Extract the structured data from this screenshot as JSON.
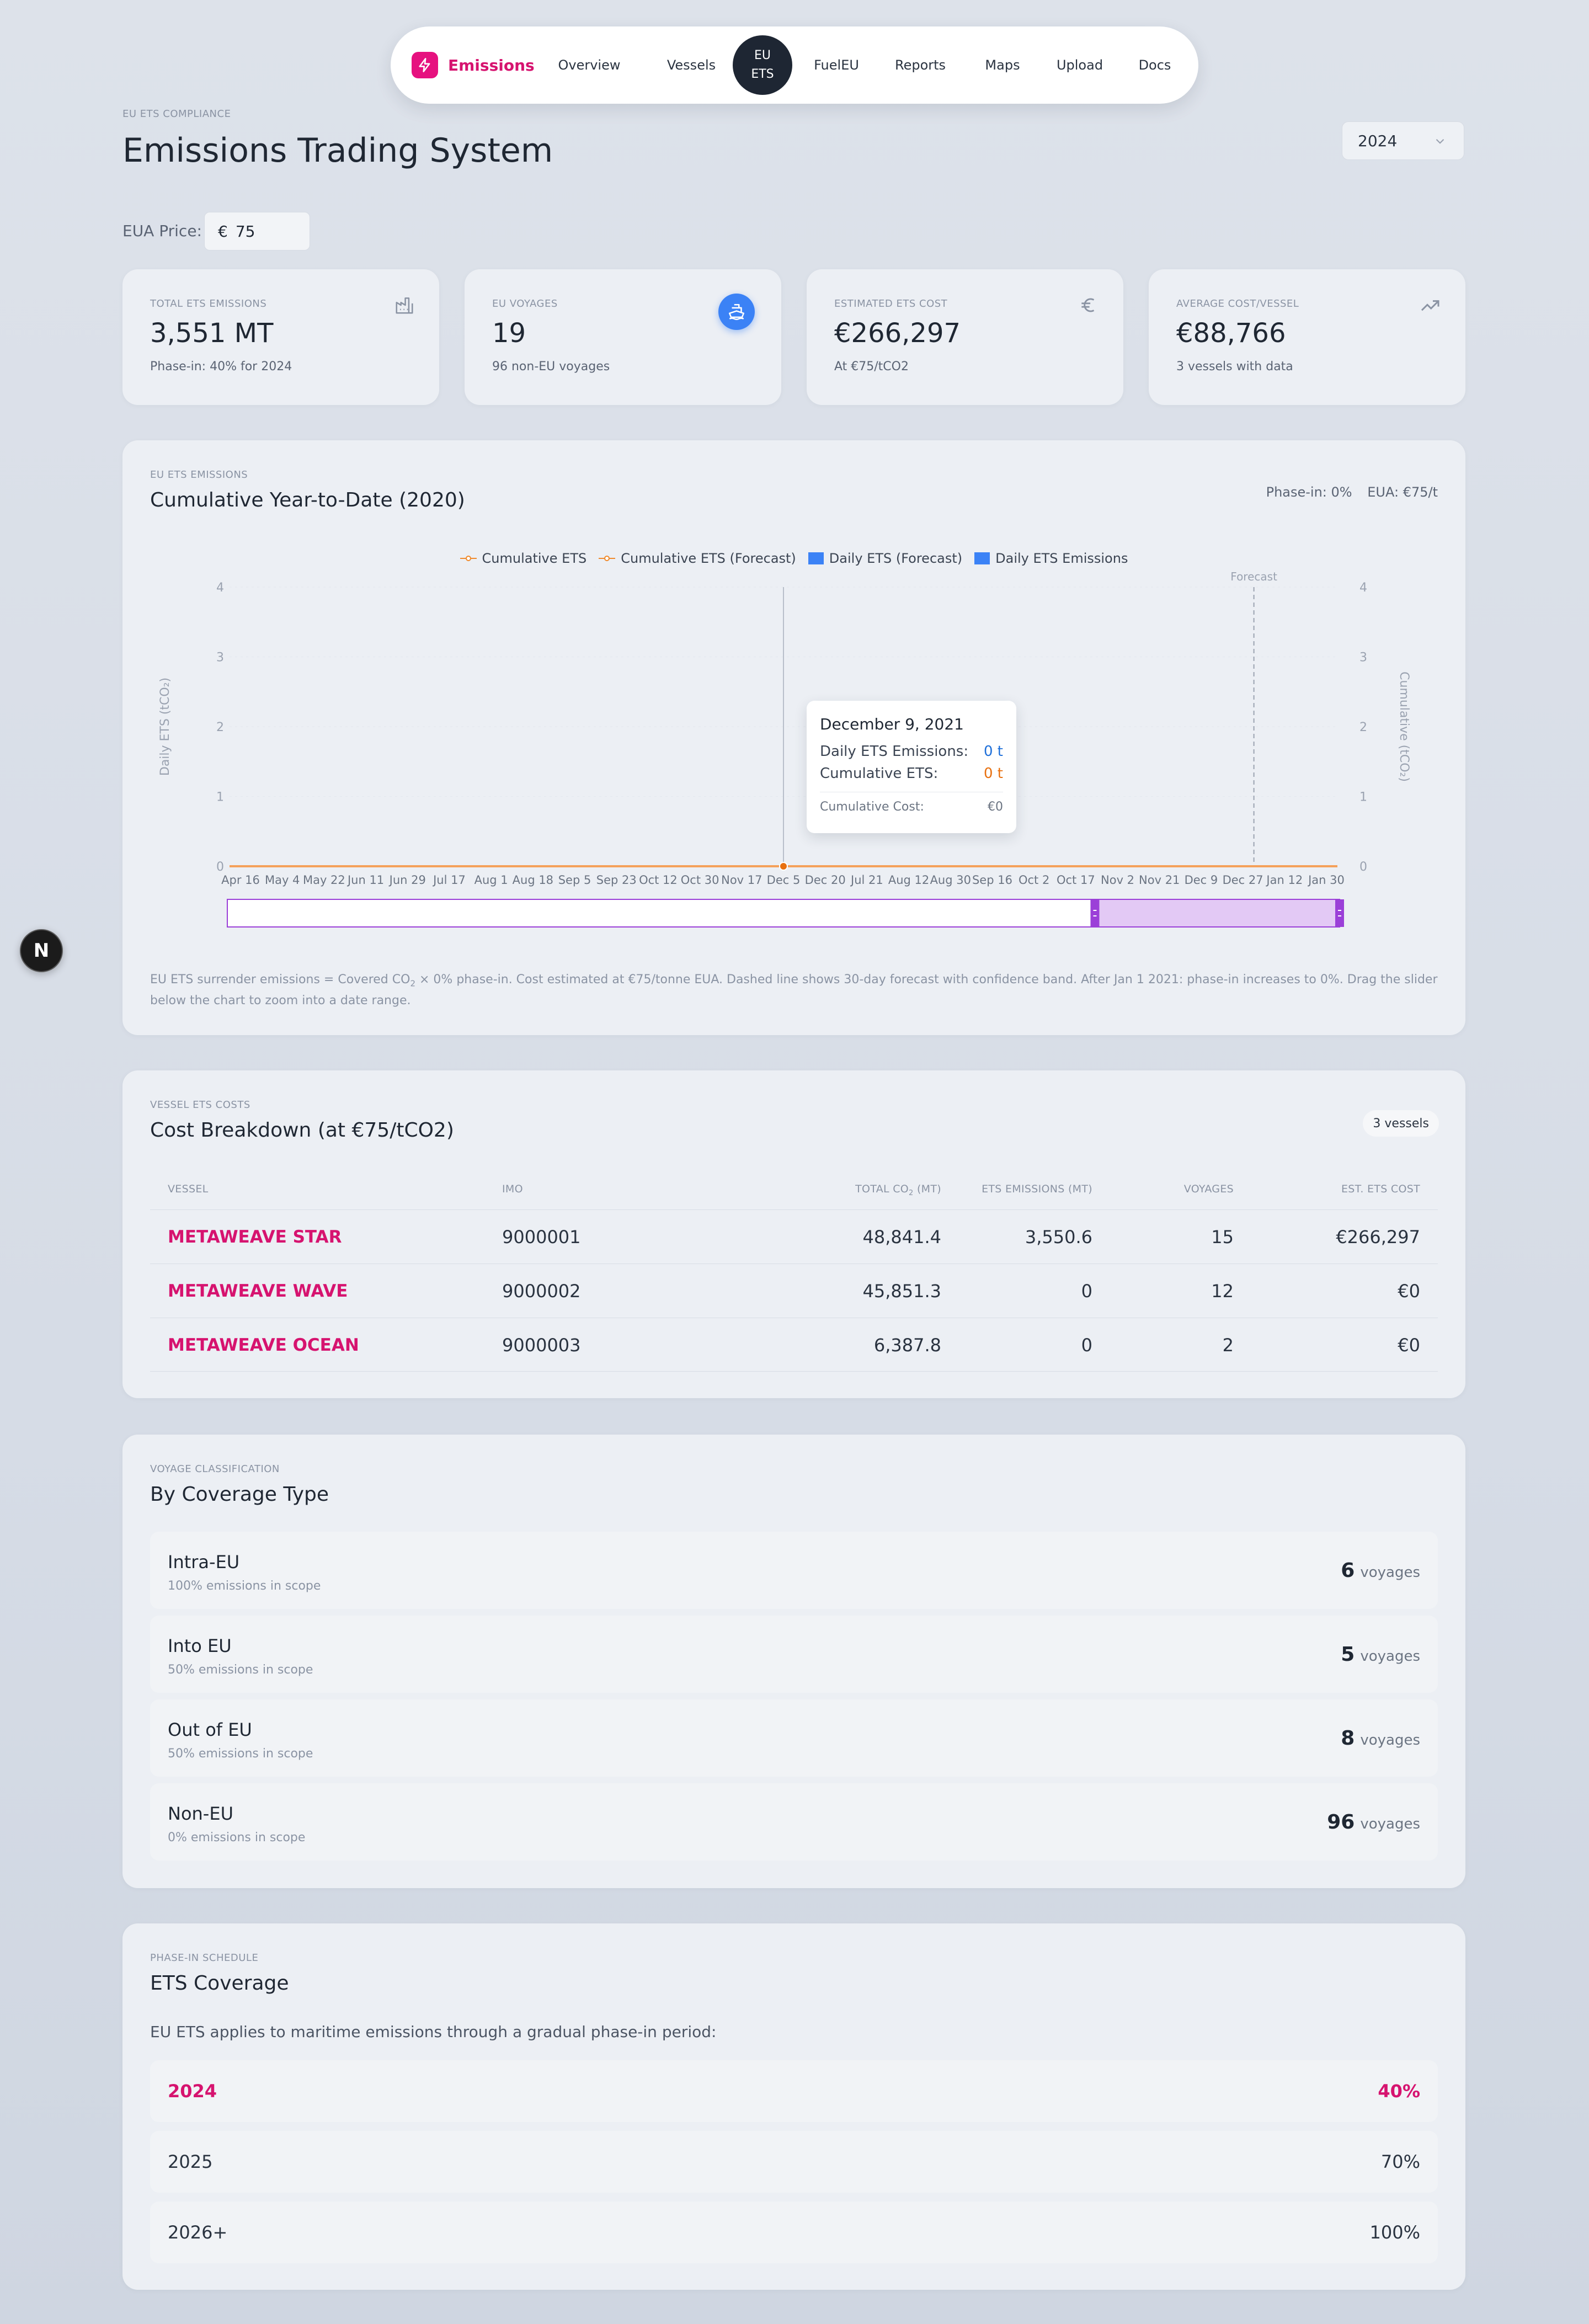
{
  "nav": {
    "brand": "Emissions",
    "items": [
      "Overview",
      "Vessels",
      "FuelEU",
      "Reports",
      "Maps",
      "Upload",
      "Docs"
    ],
    "active_line1": "EU",
    "active_line2": "ETS"
  },
  "header": {
    "eyebrow": "EU ETS COMPLIANCE",
    "title": "Emissions Trading System",
    "year": "2024"
  },
  "eua": {
    "label": "EUA Price:",
    "currency": "€",
    "value": "75"
  },
  "kpis": [
    {
      "eyebrow": "TOTAL ETS EMISSIONS",
      "value": "3,551 MT",
      "sub": "Phase-in: 40% for 2024",
      "icon": "factory-icon"
    },
    {
      "eyebrow": "EU VOYAGES",
      "value": "19",
      "sub": "96 non-EU voyages",
      "icon": "ship-icon"
    },
    {
      "eyebrow": "ESTIMATED ETS COST",
      "value": "€266,297",
      "sub": "At €75/tCO2",
      "icon": "euro-icon"
    },
    {
      "eyebrow": "AVERAGE COST/VESSEL",
      "value": "€88,766",
      "sub": "3 vessels with data",
      "icon": "trending-up-icon"
    }
  ],
  "chart_card": {
    "eyebrow": "EU ETS EMISSIONS",
    "title": "Cumulative Year-to-Date (2020)",
    "meta_phase": "Phase-in: 0%",
    "meta_eua": "EUA: €75/t",
    "footnote_a": "EU ETS surrender emissions = Covered CO",
    "footnote_sub": "2",
    "footnote_b": " × 0% phase-in. Cost estimated at €75/tonne EUA. Dashed line shows 30-day forecast with confidence band. After Jan 1 2021: phase-in increases to 0%. Drag the slider below the chart to zoom into a date range.",
    "tooltip": {
      "date": "December 9, 2021",
      "daily_label": "Daily ETS Emissions:",
      "daily_value": "0 t",
      "cum_label": "Cumulative ETS:",
      "cum_value": "0 t",
      "cost_label": "Cumulative Cost:",
      "cost_value": "€0"
    },
    "forecast_label": "Forecast"
  },
  "chart_data": {
    "type": "line",
    "legend": [
      "Cumulative ETS",
      "Cumulative ETS (Forecast)",
      "Daily ETS (Forecast)",
      "Daily ETS Emissions"
    ],
    "legend_position": "top-center",
    "ylabel_left": "Daily ETS (tCO₂)",
    "ylabel_right": "Cumulative (tCO₂)",
    "yticks_left": [
      "0",
      "1",
      "2",
      "3",
      "4"
    ],
    "yticks_right": [
      "0",
      "1",
      "2",
      "3",
      "4"
    ],
    "ylim": [
      0,
      4
    ],
    "xticks": [
      "Apr 16",
      "May 4",
      "May 22",
      "Jun 11",
      "Jun 29",
      "Jul 17",
      "Aug 1",
      "Aug 18",
      "Sep 5",
      "Sep 23",
      "Oct 12",
      "Oct 30",
      "Nov 17",
      "Dec 5",
      "Dec 20",
      "Jul 21",
      "Aug 12",
      "Aug 30",
      "Sep 16",
      "Oct 2",
      "Oct 17",
      "Nov 2",
      "Nov 21",
      "Dec 9",
      "Dec 27",
      "Jan 12",
      "Jan 30"
    ],
    "series": [
      {
        "name": "Cumulative ETS",
        "values": [
          0,
          0,
          0,
          0,
          0,
          0,
          0,
          0,
          0,
          0,
          0,
          0,
          0,
          0,
          0,
          0,
          0,
          0,
          0,
          0,
          0,
          0,
          0,
          0,
          0,
          0,
          0
        ]
      },
      {
        "name": "Daily ETS Emissions",
        "values": [
          0,
          0,
          0,
          0,
          0,
          0,
          0,
          0,
          0,
          0,
          0,
          0,
          0,
          0,
          0,
          0,
          0,
          0,
          0,
          0,
          0,
          0,
          0,
          0,
          0,
          0,
          0
        ]
      }
    ],
    "grid": true,
    "forecast_start": "Dec 27",
    "hover_index": 13,
    "brush_range_fraction": [
      0.78,
      1.0
    ]
  },
  "table_card": {
    "eyebrow": "VESSEL ETS COSTS",
    "title": "Cost Breakdown (at €75/tCO2)",
    "badge": "3 vessels",
    "headers": {
      "vessel": "VESSEL",
      "imo": "IMO",
      "total_a": "TOTAL CO",
      "total_sub": "2",
      "total_b": " (MT)",
      "ets": "ETS EMISSIONS (MT)",
      "voyages": "VOYAGES",
      "cost": "EST. ETS COST"
    },
    "rows": [
      {
        "vessel": "METAWEAVE STAR",
        "imo": "9000001",
        "total": "48,841.4",
        "ets": "3,550.6",
        "voyages": "15",
        "cost": "€266,297"
      },
      {
        "vessel": "METAWEAVE WAVE",
        "imo": "9000002",
        "total": "45,851.3",
        "ets": "0",
        "voyages": "12",
        "cost": "€0"
      },
      {
        "vessel": "METAWEAVE OCEAN",
        "imo": "9000003",
        "total": "6,387.8",
        "ets": "0",
        "voyages": "2",
        "cost": "€0"
      }
    ]
  },
  "coverage_card": {
    "eyebrow": "VOYAGE CLASSIFICATION",
    "title": "By Coverage Type",
    "unit": "voyages",
    "rows": [
      {
        "name": "Intra-EU",
        "desc": "100% emissions in scope",
        "count": "6"
      },
      {
        "name": "Into EU",
        "desc": "50% emissions in scope",
        "count": "5"
      },
      {
        "name": "Out of EU",
        "desc": "50% emissions in scope",
        "count": "8"
      },
      {
        "name": "Non-EU",
        "desc": "0% emissions in scope",
        "count": "96"
      }
    ]
  },
  "phase_card": {
    "eyebrow": "PHASE-IN SCHEDULE",
    "title": "ETS Coverage",
    "desc": "EU ETS applies to maritime emissions through a gradual phase-in period:",
    "rows": [
      {
        "year": "2024",
        "pct": "40%"
      },
      {
        "year": "2025",
        "pct": "70%"
      },
      {
        "year": "2026+",
        "pct": "100%"
      }
    ]
  },
  "floating": {
    "label": "N"
  },
  "colors": {
    "accent": "#d6136f",
    "blue": "#3b82f6",
    "orange": "#f08a2c",
    "purple": "#9b3fd8"
  }
}
